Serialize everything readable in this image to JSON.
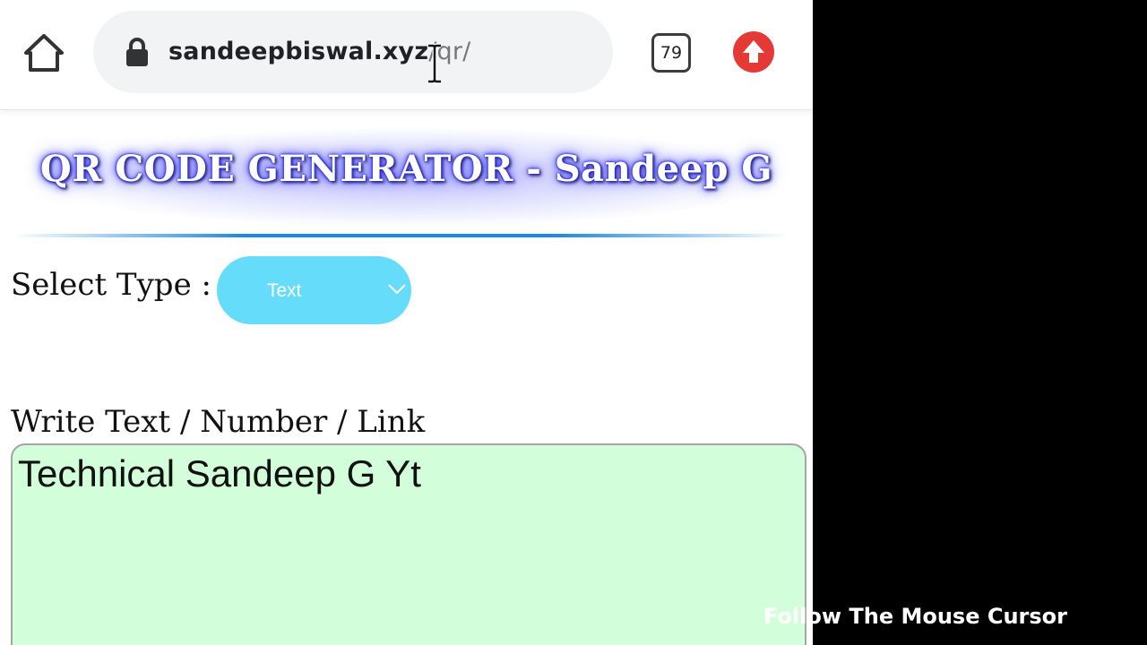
{
  "browser": {
    "url_domain": "sandeepbiswal.xyz",
    "url_path": "/qr/",
    "tab_count": "79",
    "icons": [
      "home-icon",
      "lock-icon",
      "tabs-icon",
      "upload-arrow-icon",
      "text-cursor-icon"
    ],
    "update_button_color": "#e53935"
  },
  "page": {
    "title": "QR CODE GENERATOR - Sandeep G",
    "select_label": "Select Type :",
    "select_value": "Text",
    "select_color": "#66dcfb",
    "input_label": "Write Text / Number / Link",
    "input_value": "Technical Sandeep G Yt",
    "input_bg_color": "#d2ffd9"
  },
  "overlay": {
    "caption": "Follow The Mouse Cursor"
  }
}
